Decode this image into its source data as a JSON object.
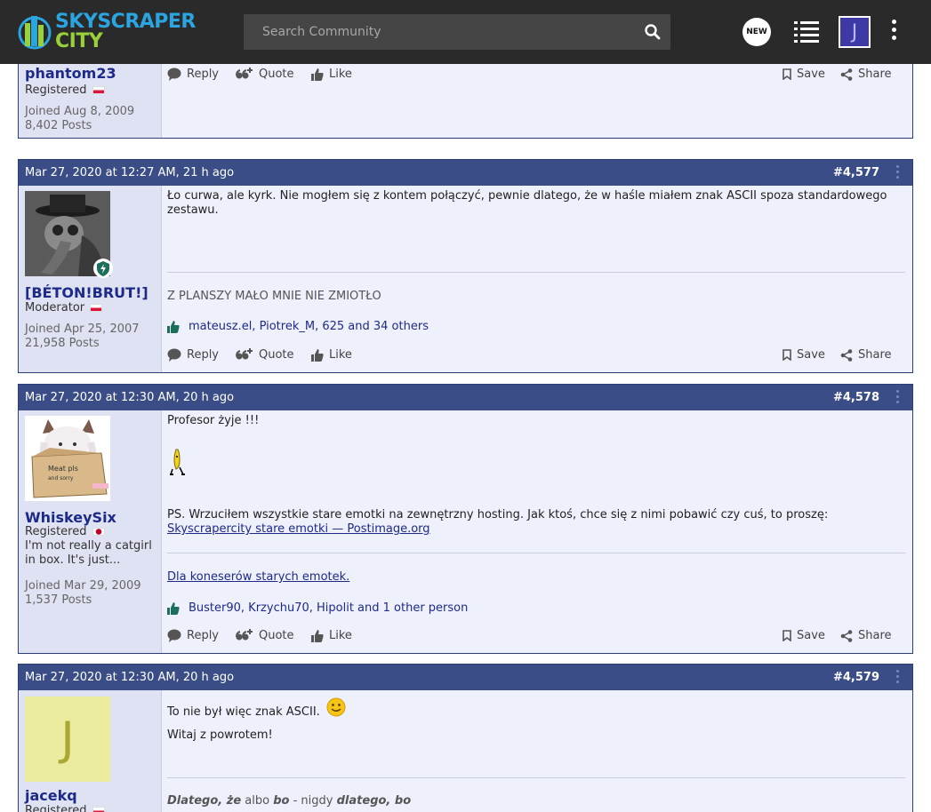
{
  "header": {
    "logo_line1": "SKYSCRAPER",
    "logo_line2": "CITY",
    "search_placeholder": "Search Community",
    "new_label": "NEW",
    "avatar_letter": "J"
  },
  "actions": {
    "reply": "Reply",
    "quote": "Quote",
    "like": "Like",
    "save": "Save",
    "share": "Share"
  },
  "posts": [
    {
      "user": "phantom23",
      "role": "Registered",
      "joined": "Joined Aug 8, 2009",
      "posts": "8,402 Posts"
    },
    {
      "date": "Mar 27, 2020 at 12:27 AM, 21 h ago",
      "number": "#4,577",
      "user": "[BÉTON!BRUT!]",
      "role": "Moderator",
      "joined": "Joined Apr 25, 2007",
      "posts": "21,958 Posts",
      "text": "Ło curwa, ale kyrk. Nie mogłem się z kontem połączyć, pewnie dlatego, że w haśle miałem znak ASCII spoza standardowego zestawu.",
      "signature": "Z PLANSZY MAŁO MNIE NIE ZMIOTŁO",
      "likes": "mateusz.el, Piotrek_M, 625 and 34 others"
    },
    {
      "date": "Mar 27, 2020 at 12:30 AM, 20 h ago",
      "number": "#4,578",
      "user": "WhiskeySix",
      "role": "Registered",
      "bio": "I'm not really a catgirl in box. It's just...",
      "joined": "Joined Mar 29, 2009",
      "posts": "1,537 Posts",
      "text1": "Profesor żyje !!!",
      "text2": "PS. Wrzuciłem wszystkie stare emotki na zewnętrzny hosting. Jak ktoś, chce się z nimi pobawić czy cuś, to proszę:",
      "link1": "Skyscrapercity stare emotki — Postimage.org",
      "signature_link": "Dla koneserów starych emotek.",
      "likes": "Buster90, Krzychu70, Hipolit and 1 other person"
    },
    {
      "date": "Mar 27, 2020 at 12:30 AM, 20 h ago",
      "number": "#4,579",
      "user": "jacekq",
      "role": "Registered",
      "avatar_letter": "J",
      "text1": "To nie był więc znak ASCII.",
      "text2": "Witaj z powrotem!",
      "sig_a": "Dlatego, że",
      "sig_b": "albo",
      "sig_c": "bo",
      "sig_d": "- nigdy",
      "sig_e": "dlatego, bo"
    }
  ]
}
